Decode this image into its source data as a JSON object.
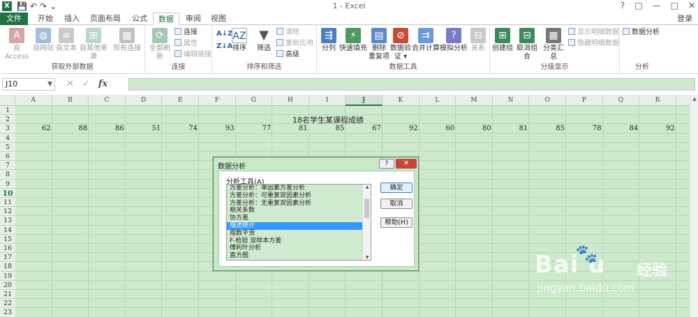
{
  "window": {
    "title": "1 - Excel",
    "logo": "X",
    "controls": [
      "?",
      "□",
      "—",
      "□",
      "✕"
    ]
  },
  "qat": [
    "save-icon",
    "undo-icon",
    "redo-icon",
    "customize-icon"
  ],
  "tabs": [
    {
      "label": "文件"
    },
    {
      "label": "开始"
    },
    {
      "label": "插入"
    },
    {
      "label": "页面布局"
    },
    {
      "label": "公式"
    },
    {
      "label": "数据"
    },
    {
      "label": "审阅"
    },
    {
      "label": "视图"
    }
  ],
  "login_label": "登录",
  "ribbon": {
    "groups": {
      "external": "获取外部数据",
      "connections": "连接",
      "sortfilter": "排序和筛选",
      "datatools": "数据工具",
      "outline": "分级显示",
      "analysis": "分析"
    },
    "buttons": {
      "access": "自 Access",
      "web": "自网站",
      "text": "自文本",
      "other": "自其他来源",
      "existing": "现有连接",
      "refresh": "全部刷新",
      "connections": "连接",
      "properties": "属性",
      "editlinks": "编辑链接",
      "sort_az": "A↓Z",
      "sort_za": "Z↓A",
      "sort": "排序",
      "filter": "筛选",
      "clear": "清除",
      "reapply": "重新应用",
      "advanced": "高级",
      "split": "分列",
      "flashfill": "快速填充",
      "removedup1": "删除",
      "removedup2": "重复项",
      "validate1": "数据验",
      "validate2": "证 ▾",
      "consolidate": "合并计算",
      "whatif": "模拟分析",
      "relations": "关系",
      "group": "创建组",
      "ungroup": "取消组合",
      "subtotal": "分类汇总",
      "showdetail": "显示明细数据",
      "hidedetail": "隐藏明细数据",
      "dataanalysis": "数据分析"
    }
  },
  "namebox": "J10",
  "formula_buttons": {
    "cancel": "✕",
    "enter": "✓",
    "fx": "fx"
  },
  "columns": [
    "A",
    "B",
    "C",
    "D",
    "E",
    "F",
    "G",
    "H",
    "I",
    "J",
    "K",
    "L",
    "M",
    "N",
    "O",
    "P",
    "Q",
    "R"
  ],
  "selected_column": "J",
  "rows": [
    "1",
    "2",
    "3",
    "4",
    "5",
    "6",
    "7",
    "8",
    "9",
    "10",
    "11",
    "12",
    "13",
    "14",
    "15",
    "16",
    "17",
    "18",
    "19",
    "20",
    "21",
    "22",
    "23"
  ],
  "selected_row": "10",
  "sheet_title": "18名学生某课程成绩",
  "scores": [
    "62",
    "88",
    "86",
    "51",
    "74",
    "93",
    "77",
    "81",
    "85",
    "67",
    "92",
    "60",
    "80",
    "81",
    "85",
    "78",
    "84",
    "92"
  ],
  "dialog": {
    "title": "数据分析",
    "help_btn": "?",
    "close_btn": "✕",
    "tool_label": "分析工具(A)",
    "tools": [
      "方差分析：单因素方差分析",
      "方差分析：可重复双因素分析",
      "方差分析：无重复双因素分析",
      "相关系数",
      "协方差",
      "描述统计",
      "指数平滑",
      "F-检验 双样本方差",
      "傅利叶分析",
      "直方图"
    ],
    "selected_tool": "描述统计",
    "ok": "确定",
    "cancel": "取消",
    "help": "帮助(H)"
  },
  "watermark": {
    "brand": "Bai  u",
    "cn": "经验",
    "url": "jingyan.baidu.com"
  },
  "colors": {
    "excel_green": "#217346",
    "grid_bg": "#cdeacd",
    "selection_blue": "#3399ff"
  }
}
